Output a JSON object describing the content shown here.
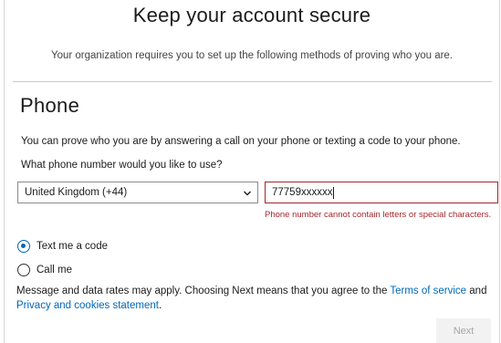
{
  "header": {
    "title": "Keep your account secure",
    "subtitle": "Your organization requires you to set up the following methods of proving who you are."
  },
  "section": {
    "title": "Phone",
    "description": "You can prove who you are by answering a call on your phone or texting a code to your phone.",
    "question": "What phone number would you like to use?"
  },
  "country_select": {
    "value": "United Kingdom (+44)",
    "icon": "chevron-down-icon"
  },
  "phone_input": {
    "value": "77759xxxxxx",
    "error": "Phone number cannot contain letters or special characters.",
    "error_color": "#a4262c"
  },
  "options": [
    {
      "label": "Text me a code",
      "selected": true
    },
    {
      "label": "Call me",
      "selected": false
    }
  ],
  "disclaimer": {
    "text_before": "Message and data rates may apply. Choosing Next means that you agree to the ",
    "terms_link": "Terms of service",
    "text_between": " and ",
    "privacy_link": "Privacy and cookies statement",
    "text_after": "."
  },
  "buttons": {
    "next_label": "Next"
  },
  "colors": {
    "accent": "#0067b8",
    "error": "#a4262c",
    "disabled_button_bg": "#f2f2f2"
  }
}
